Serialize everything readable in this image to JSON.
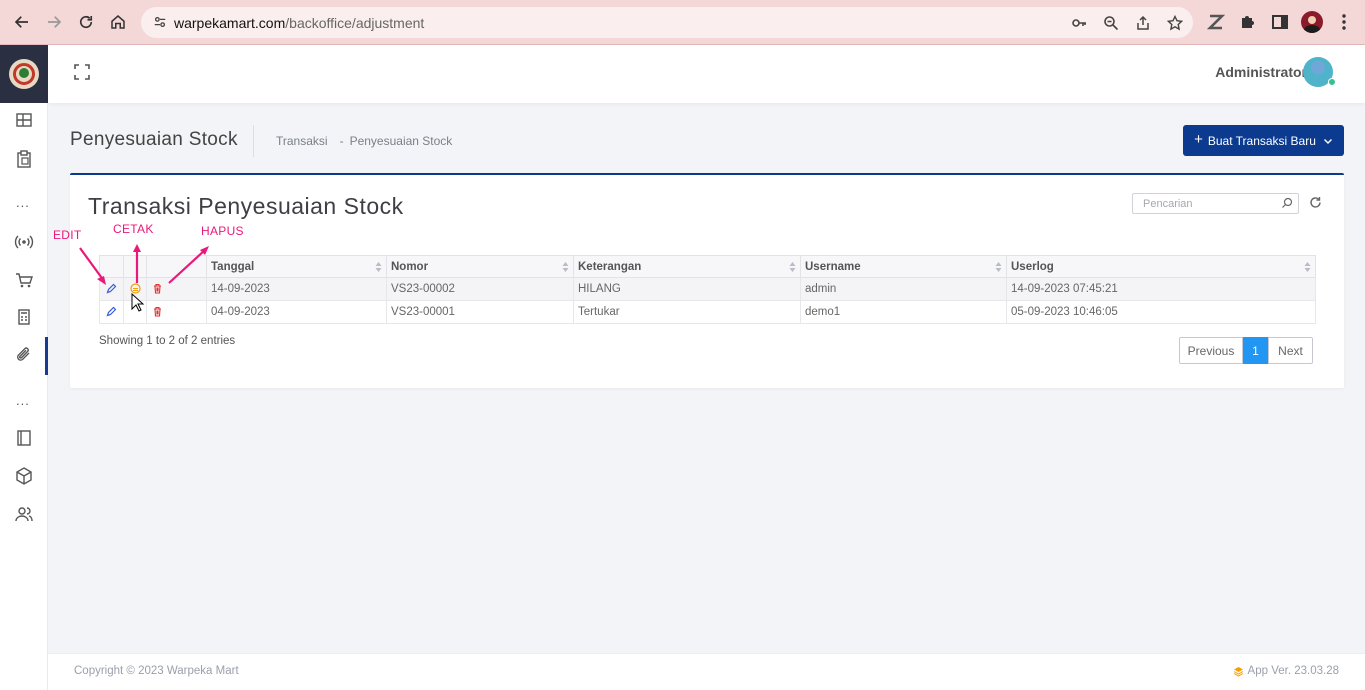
{
  "browser": {
    "url_host": "warpekamart.com",
    "url_path": "/backoffice/adjustment"
  },
  "header": {
    "user_name": "Administrator"
  },
  "page": {
    "title": "Penyesuaian Stock",
    "breadcrumb": [
      "Transaksi",
      "-",
      "Penyesuaian Stock"
    ],
    "new_button_label": "Buat Transaksi Baru"
  },
  "card": {
    "title": "Transaksi Penyesuaian Stock",
    "search_placeholder": "Pencarian"
  },
  "table": {
    "columns": [
      "Tanggal",
      "Nomor",
      "Keterangan",
      "Username",
      "Userlog"
    ],
    "rows": [
      {
        "tanggal": "14-09-2023",
        "nomor": "VS23-00002",
        "keterangan": "HILANG",
        "username": "admin",
        "userlog": "14-09-2023 07:45:21"
      },
      {
        "tanggal": "04-09-2023",
        "nomor": "VS23-00001",
        "keterangan": "Tertukar",
        "username": "demo1",
        "userlog": "05-09-2023 10:46:05"
      }
    ],
    "info": "Showing 1 to 2 of 2 entries",
    "pagination": {
      "previous": "Previous",
      "current": "1",
      "next": "Next"
    }
  },
  "annotations": {
    "edit": "EDIT",
    "cetak": "CETAK",
    "hapus": "HAPUS",
    "color": "#e8197a"
  },
  "footer": {
    "copyright": "Copyright © 2023 Warpeka Mart",
    "version": "App Ver. 23.03.28"
  },
  "colors": {
    "primary": "#0b3a8f",
    "pager_active": "#2196f3",
    "edit_icon": "#3b5bdb",
    "print_icon": "#f59f00",
    "delete_icon": "#e03131"
  }
}
